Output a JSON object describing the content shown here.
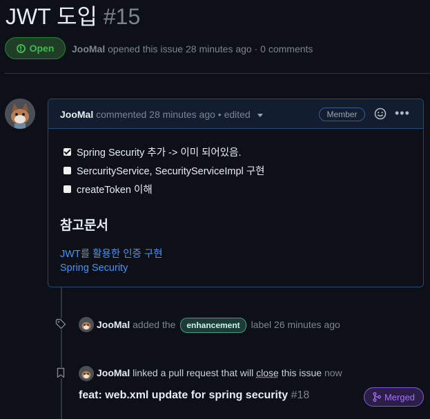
{
  "issue": {
    "title": "JWT 도입",
    "number": "#15",
    "state": "Open",
    "author": "JooMal",
    "meta_text": "opened this issue 28 minutes ago · 0 comments"
  },
  "comment": {
    "author": "JooMal",
    "header_text": "commented 28 minutes ago • edited",
    "role_badge": "Member",
    "tasks": [
      {
        "text": "Spring Security 추가 -> 이미 되어있음.",
        "checked": true
      },
      {
        "text": "SercurityService, SecurityServiceImpl 구현",
        "checked": false
      },
      {
        "text": "createToken 이해",
        "checked": false
      }
    ],
    "heading": "참고문서",
    "links": [
      "JWT를 활용한 인증 구현",
      "Spring Security"
    ]
  },
  "timeline": {
    "label_event": {
      "actor": "JooMal",
      "text_before": "added the",
      "label": "enhancement",
      "text_after": "label 26 minutes ago"
    },
    "pr_event": {
      "actor": "JooMal",
      "text_before": "linked a pull request that will",
      "close_word": "close",
      "text_after": "this issue",
      "time": "now",
      "pr_title": "feat: web.xml update for spring security",
      "pr_number": "#18",
      "pr_state": "Merged"
    }
  },
  "colors": {
    "background": "#0d1117",
    "open_green": "#3fb950",
    "link_blue": "#4493f8",
    "merged_purple": "#a371f7",
    "comment_border": "#1f4a7a"
  }
}
